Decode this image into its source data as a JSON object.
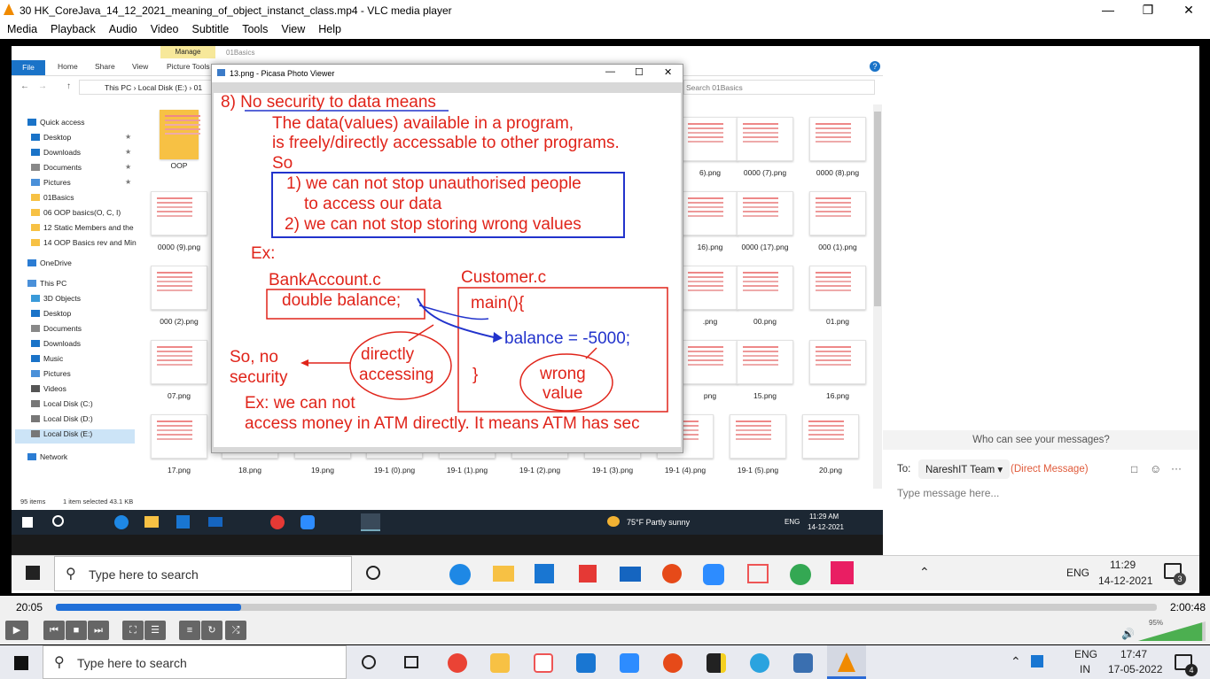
{
  "vlc": {
    "title": "30 HK_CoreJava_14_12_2021_meaning_of_object_instanct_class.mp4 - VLC media player",
    "menu": [
      "Media",
      "Playback",
      "Audio",
      "Video",
      "Subtitle",
      "Tools",
      "View",
      "Help"
    ],
    "time_current": "20:05",
    "time_total": "2:00:48",
    "progress_fraction": 0.168,
    "volume": "95%"
  },
  "explorer": {
    "ribbon_context": "Manage",
    "folder_title": "01Basics",
    "tabs": [
      "File",
      "Home",
      "Share",
      "View",
      "Picture Tools"
    ],
    "address": [
      "This PC",
      "Local Disk (E:)",
      "01"
    ],
    "search_placeholder": "Search 01Basics",
    "nav": [
      {
        "label": "Quick access"
      },
      {
        "label": "Desktop"
      },
      {
        "label": "Downloads"
      },
      {
        "label": "Documents"
      },
      {
        "label": "Pictures"
      },
      {
        "label": "01Basics"
      },
      {
        "label": "06 OOP basics(O, C, I)"
      },
      {
        "label": "12 Static Members and the"
      },
      {
        "label": "14 OOP Basics rev and Min"
      },
      {
        "label": "OneDrive"
      },
      {
        "label": "This PC"
      },
      {
        "label": "3D Objects"
      },
      {
        "label": "Desktop"
      },
      {
        "label": "Documents"
      },
      {
        "label": "Downloads"
      },
      {
        "label": "Music"
      },
      {
        "label": "Pictures"
      },
      {
        "label": "Videos"
      },
      {
        "label": "Local Disk (C:)"
      },
      {
        "label": "Local Disk (D:)"
      },
      {
        "label": "Local Disk (E:)"
      },
      {
        "label": "Network"
      }
    ],
    "files_left": [
      "OOP",
      "0000 (9).png",
      "000 (2).png",
      "07.png",
      "17.png",
      "18.png",
      "19.png"
    ],
    "files_right": [
      "6).png",
      "0000 (7).png",
      "0000 (8).png",
      "16).png",
      "0000 (17).png",
      "000 (1).png",
      ".png",
      "00.png",
      "01.png",
      "png",
      "15.png",
      "16.png"
    ],
    "files_bottom": [
      "19-1 (0).png",
      "19-1 (1).png",
      "19-1 (2).png",
      "19-1 (3).png",
      "19-1 (4).png",
      "19-1 (5).png",
      "20.png"
    ],
    "status_items": "95 items",
    "status_selected": "1 item selected  43.1 KB"
  },
  "picasa": {
    "title": "13.png - Picasa Photo Viewer"
  },
  "slide": {
    "heading": "8) No security to data means",
    "line1": "The data(values) available in a program,",
    "line2": "is freely/directly accessable to other programs.",
    "line3": "So",
    "box1": "1) we can not stop unauthorised people",
    "box2": "to access our data",
    "box3": "2) we can not stop storing wrong values",
    "ex": "Ex:",
    "bank_file": "BankAccount.c",
    "bank_code": "double balance;",
    "cust_file": "Customer.c",
    "main": "main(){",
    "assign": "balance = -5000;",
    "close": "}",
    "so_no": "So, no",
    "security": "security",
    "directly": "directly",
    "accessing": "accessing",
    "wrong": "wrong",
    "value": "value",
    "ex2": "Ex: we can not",
    "atm": "access money in ATM directly. It means ATM has sec"
  },
  "inner_taskbar": {
    "weather": "75°F  Partly sunny",
    "lang": "ENG",
    "time": "11:29 AM",
    "date": "14-12-2021"
  },
  "chat": {
    "who": "Who can see your messages?",
    "to_label": "To:",
    "recipient": "NareshIT Team",
    "direct": "(Direct Message)",
    "placeholder": "Type message here..."
  },
  "inner_taskbar2": {
    "search": "Type here to search",
    "lang": "ENG",
    "time": "11:29",
    "date": "14-12-2021",
    "badge": "3"
  },
  "host_taskbar": {
    "search": "Type here to search",
    "lang": "ENG",
    "region": "IN",
    "time": "17:47",
    "date": "17-05-2022",
    "badge": "4"
  }
}
